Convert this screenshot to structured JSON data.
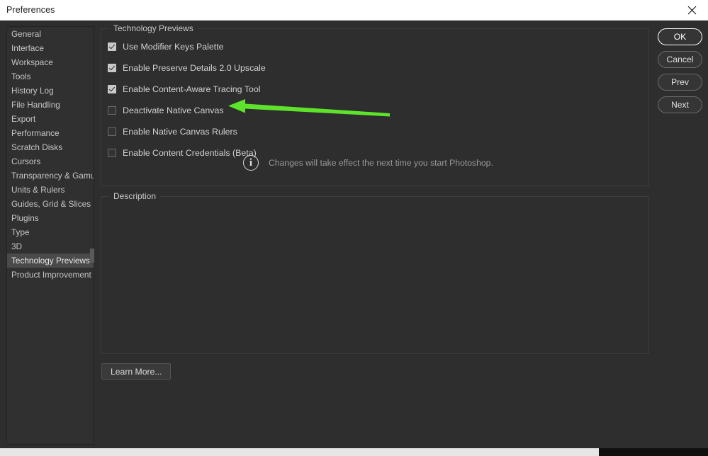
{
  "window": {
    "title": "Preferences",
    "close_icon": "close-x-icon"
  },
  "sidebar": {
    "items": [
      {
        "label": "General",
        "selected": false
      },
      {
        "label": "Interface",
        "selected": false
      },
      {
        "label": "Workspace",
        "selected": false
      },
      {
        "label": "Tools",
        "selected": false
      },
      {
        "label": "History Log",
        "selected": false
      },
      {
        "label": "File Handling",
        "selected": false
      },
      {
        "label": "Export",
        "selected": false
      },
      {
        "label": "Performance",
        "selected": false
      },
      {
        "label": "Scratch Disks",
        "selected": false
      },
      {
        "label": "Cursors",
        "selected": false
      },
      {
        "label": "Transparency & Gamut",
        "selected": false
      },
      {
        "label": "Units & Rulers",
        "selected": false
      },
      {
        "label": "Guides, Grid & Slices",
        "selected": false
      },
      {
        "label": "Plugins",
        "selected": false
      },
      {
        "label": "Type",
        "selected": false
      },
      {
        "label": "3D",
        "selected": false
      },
      {
        "label": "Technology Previews",
        "selected": true
      },
      {
        "label": "Product Improvement",
        "selected": false
      }
    ]
  },
  "tech_previews": {
    "group_title": "Technology Previews",
    "options": [
      {
        "label": "Use Modifier Keys Palette",
        "checked": true
      },
      {
        "label": "Enable Preserve Details 2.0 Upscale",
        "checked": true
      },
      {
        "label": "Enable Content-Aware Tracing Tool",
        "checked": true
      },
      {
        "label": "Deactivate Native Canvas",
        "checked": false
      },
      {
        "label": "Enable Native Canvas Rulers",
        "checked": false
      },
      {
        "label": "Enable Content Credentials (Beta)",
        "checked": false
      }
    ],
    "note": {
      "icon": "info-circle-icon",
      "text": "Changes will take effect the next time you start Photoshop."
    }
  },
  "description": {
    "group_title": "Description",
    "body": ""
  },
  "learn_more": {
    "label": "Learn More..."
  },
  "buttons": [
    {
      "label": "OK",
      "primary": true
    },
    {
      "label": "Cancel",
      "primary": false
    },
    {
      "label": "Prev",
      "primary": false
    },
    {
      "label": "Next",
      "primary": false
    }
  ],
  "annotation": {
    "type": "arrow",
    "points_to": "Deactivate Native Canvas",
    "color": "#5ee32b",
    "direction": "left"
  },
  "colors": {
    "dialog_bg": "#2e2e2e",
    "titlebar_bg": "#ffffff",
    "selection_bg": "#4a4a4a",
    "text": "#d2d2d2",
    "muted_text": "#9a9a9a",
    "annotation_green": "#5ee32b"
  }
}
